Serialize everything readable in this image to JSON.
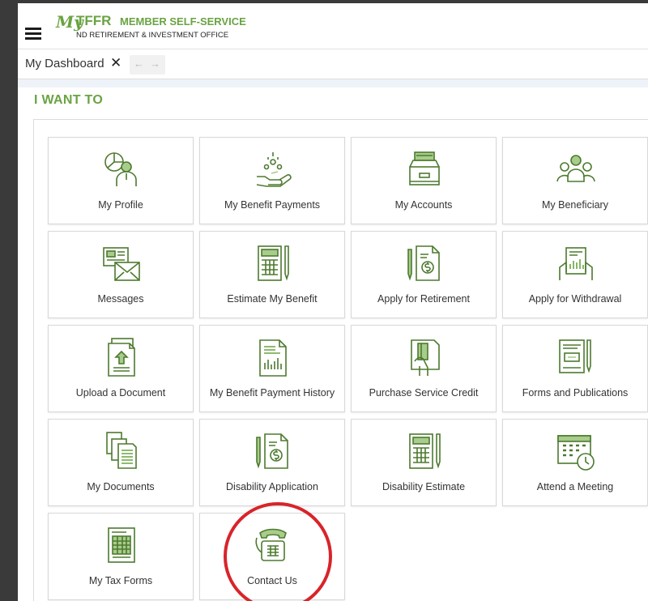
{
  "header": {
    "logo_script": "My",
    "logo_brand": "TFFR",
    "logo_tagline": "MEMBER SELF-SERVICE",
    "logo_subtitle": "ND RETIREMENT & INVESTMENT OFFICE"
  },
  "tabbar": {
    "tab_label": "My Dashboard",
    "close_glyph": "✕",
    "back_glyph": "←",
    "forward_glyph": "→"
  },
  "section": {
    "title": "I WANT TO"
  },
  "colors": {
    "accent": "#6aa342",
    "icon_stroke": "#4d7a2e",
    "highlight": "#d8242a"
  },
  "tiles": [
    {
      "label": "My Profile",
      "icon": "profile-chart-icon"
    },
    {
      "label": "My Benefit Payments",
      "icon": "hand-coins-icon"
    },
    {
      "label": "My Accounts",
      "icon": "file-drawer-icon"
    },
    {
      "label": "My Beneficiary",
      "icon": "people-group-icon"
    },
    {
      "label": "Messages",
      "icon": "envelope-message-icon"
    },
    {
      "label": "Estimate My Benefit",
      "icon": "calculator-pen-icon"
    },
    {
      "label": "Apply for Retirement",
      "icon": "dollar-document-icon"
    },
    {
      "label": "Apply for Withdrawal",
      "icon": "hands-chart-icon"
    },
    {
      "label": "Upload a Document",
      "icon": "upload-document-icon"
    },
    {
      "label": "My Benefit Payment History",
      "icon": "chart-document-icon"
    },
    {
      "label": "Purchase Service Credit",
      "icon": "card-in-hand-icon"
    },
    {
      "label": "Forms and Publications",
      "icon": "form-pen-icon"
    },
    {
      "label": "My Documents",
      "icon": "documents-stack-icon"
    },
    {
      "label": "Disability Application",
      "icon": "dollar-document-icon"
    },
    {
      "label": "Disability Estimate",
      "icon": "calculator-pen-icon"
    },
    {
      "label": "Attend a Meeting",
      "icon": "calendar-clock-icon"
    },
    {
      "label": "My Tax Forms",
      "icon": "tax-form-icon"
    },
    {
      "label": "Contact Us",
      "icon": "telephone-icon"
    }
  ]
}
